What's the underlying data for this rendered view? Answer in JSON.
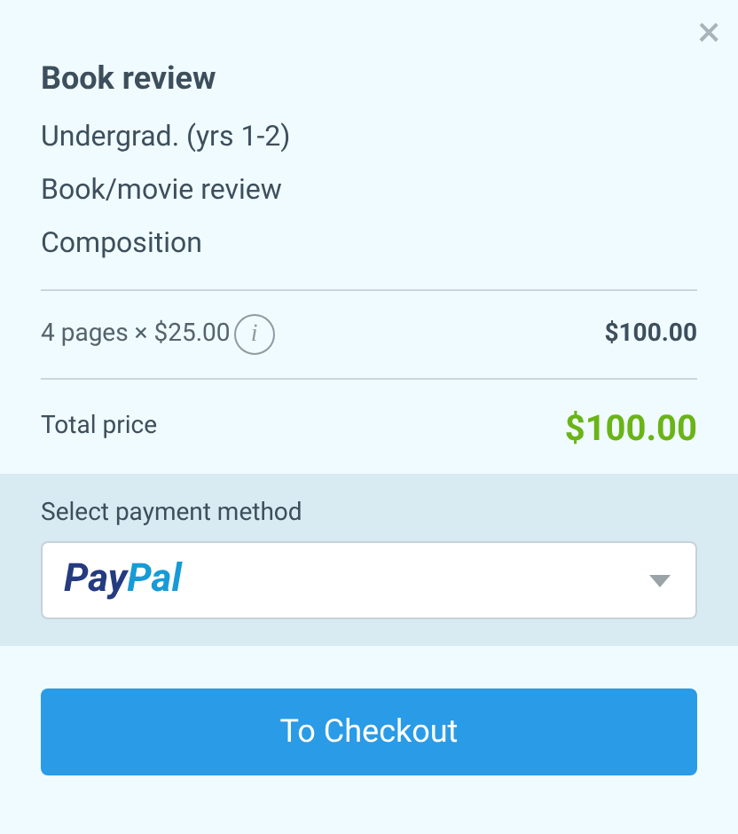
{
  "close_button": {
    "label": "×"
  },
  "order": {
    "title": "Book review",
    "details": [
      "Undergrad. (yrs 1-2)",
      "Book/movie review",
      "Composition"
    ]
  },
  "price_line": {
    "label": "4 pages × $25.00",
    "info_icon": "i",
    "amount": "$100.00"
  },
  "total": {
    "label": "Total price",
    "amount": "$100.00"
  },
  "payment": {
    "label": "Select payment method",
    "selected_logo": [
      "Pay",
      "Pal"
    ]
  },
  "checkout_button": {
    "label": "To Checkout"
  }
}
